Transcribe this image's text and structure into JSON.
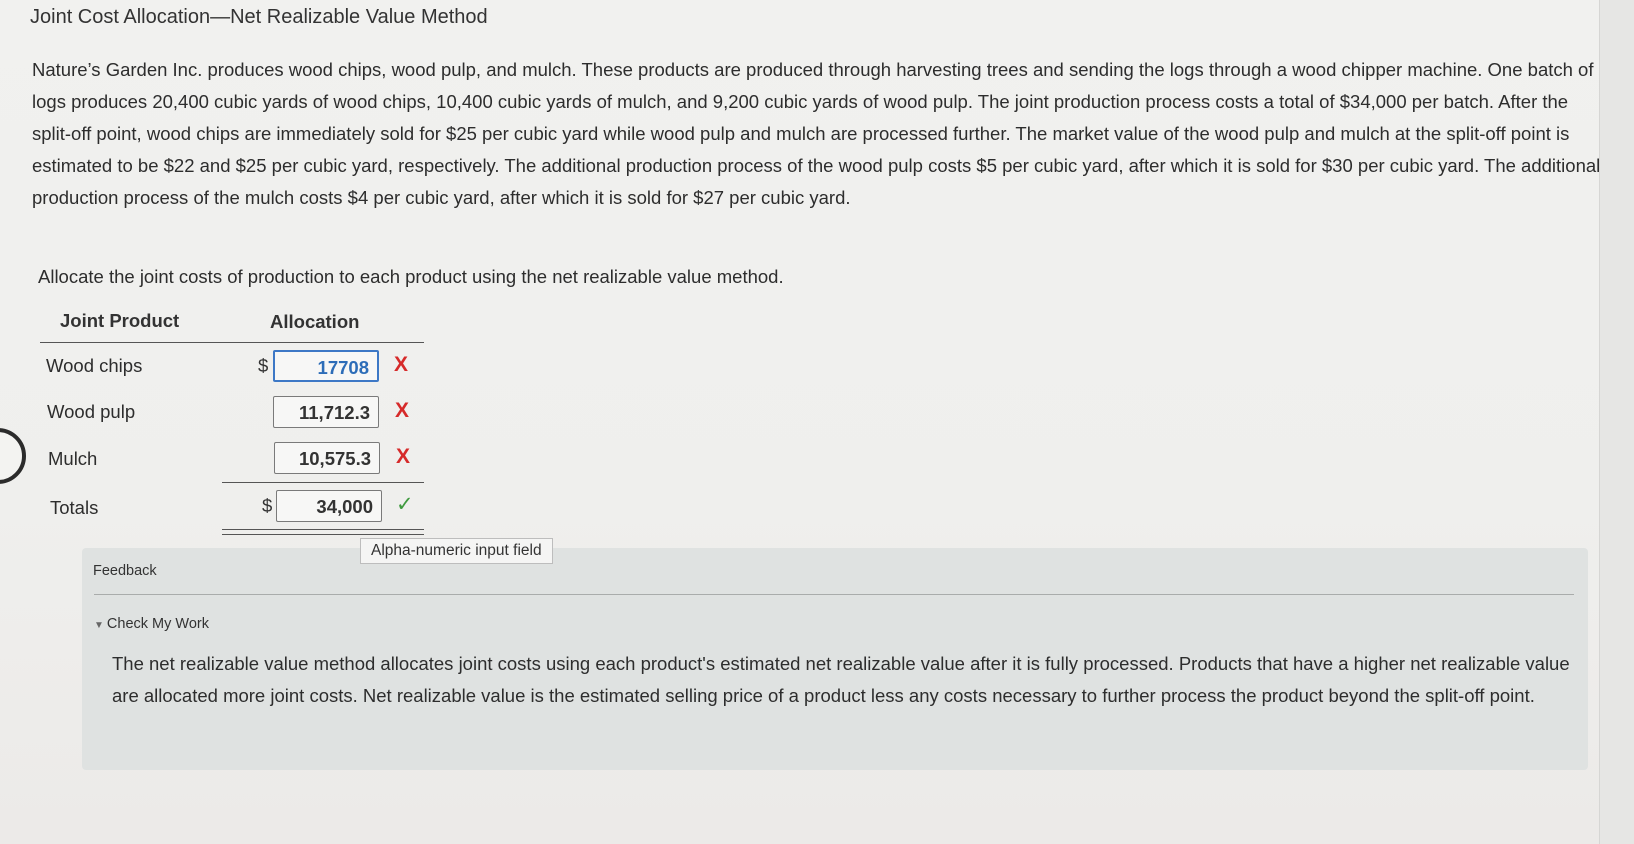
{
  "title": "Joint Cost Allocation—Net Realizable Value Method",
  "problem_text": "Nature’s Garden Inc. produces wood chips, wood pulp, and mulch. These products are produced through harvesting trees and sending the logs through a wood chipper machine. One batch of logs produces 20,400 cubic yards of wood chips, 10,400 cubic yards of mulch, and 9,200 cubic yards of wood pulp. The joint production process costs a total of $34,000 per batch. After the split-off point, wood chips are immediately sold for $25 per cubic yard while wood pulp and mulch are processed further. The market value of the wood pulp and mulch at the split-off point is estimated to be $22 and $25 per cubic yard, respectively. The additional production process of the wood pulp costs $5 per cubic yard, after which it is sold for $30 per cubic yard. The additional production process of the mulch costs $4 per cubic yard, after which it is sold for $27 per cubic yard.",
  "instruction": "Allocate the joint costs of production to each product using the net realizable value method.",
  "table": {
    "header_product": "Joint Product",
    "header_allocation": "Allocation",
    "currency_symbol": "$",
    "rows": [
      {
        "label": "Wood chips",
        "value": "17708",
        "mark": "X"
      },
      {
        "label": "Wood pulp",
        "value": "11,712.3",
        "mark": "X"
      },
      {
        "label": "Mulch",
        "value": "10,575.3",
        "mark": "X"
      }
    ],
    "totals": {
      "label": "Totals",
      "value": "34,000",
      "mark": "✓"
    }
  },
  "tooltip": "Alpha-numeric input field",
  "feedback": {
    "title": "Feedback",
    "toggle_label": "Check My Work",
    "text": "The net realizable value method allocates joint costs using each product's estimated net realizable value after it is fully processed. Products that have a higher net realizable value are allocated more joint costs. Net realizable value is the estimated selling price of a product less any costs necessary to further process the product beyond the split-off point."
  }
}
